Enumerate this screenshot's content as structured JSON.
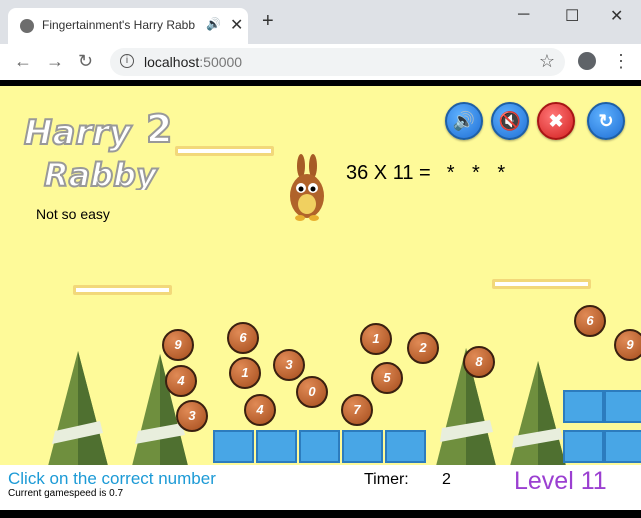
{
  "browser": {
    "tab_title": "Fingertainment's Harry Rabb",
    "address_host": "localhost",
    "address_port": ":50000",
    "favicon": "page-favicon-icon",
    "icons": [
      "audio-icon",
      "close-tab-icon",
      "new-tab-icon",
      "minimize-icon",
      "maximize-icon",
      "close-window-icon",
      "back-icon",
      "forward-icon",
      "reload-icon",
      "site-info-icon",
      "bookmark-star-icon",
      "profile-icon",
      "menu-icon"
    ]
  },
  "game": {
    "logo_text_1": "Harry",
    "logo_text_2": "2",
    "logo_text_3": "Rabby",
    "difficulty": "Not so easy",
    "question": "36 X 11 =",
    "answer_mask": "* * *",
    "controls": {
      "sound_on_icon": "speaker-on-icon",
      "mute_icon": "speaker-mute-icon",
      "quit_icon": "close-x-icon",
      "restart_icon": "restart-icon"
    },
    "balls": [
      "9",
      "4",
      "3",
      "6",
      "1",
      "4",
      "3",
      "0",
      "7",
      "1",
      "5",
      "2",
      "8",
      "6",
      "9"
    ],
    "colors": {
      "background": "#fefa99",
      "level": "#9b3fd1",
      "instruction": "#1c9ad6"
    }
  },
  "status": {
    "instruction": "Click on the correct number",
    "gamespeed": "Current gamespeed is 0.7",
    "timer_label": "Timer:",
    "timer_value": "2",
    "level": "Level 11"
  }
}
